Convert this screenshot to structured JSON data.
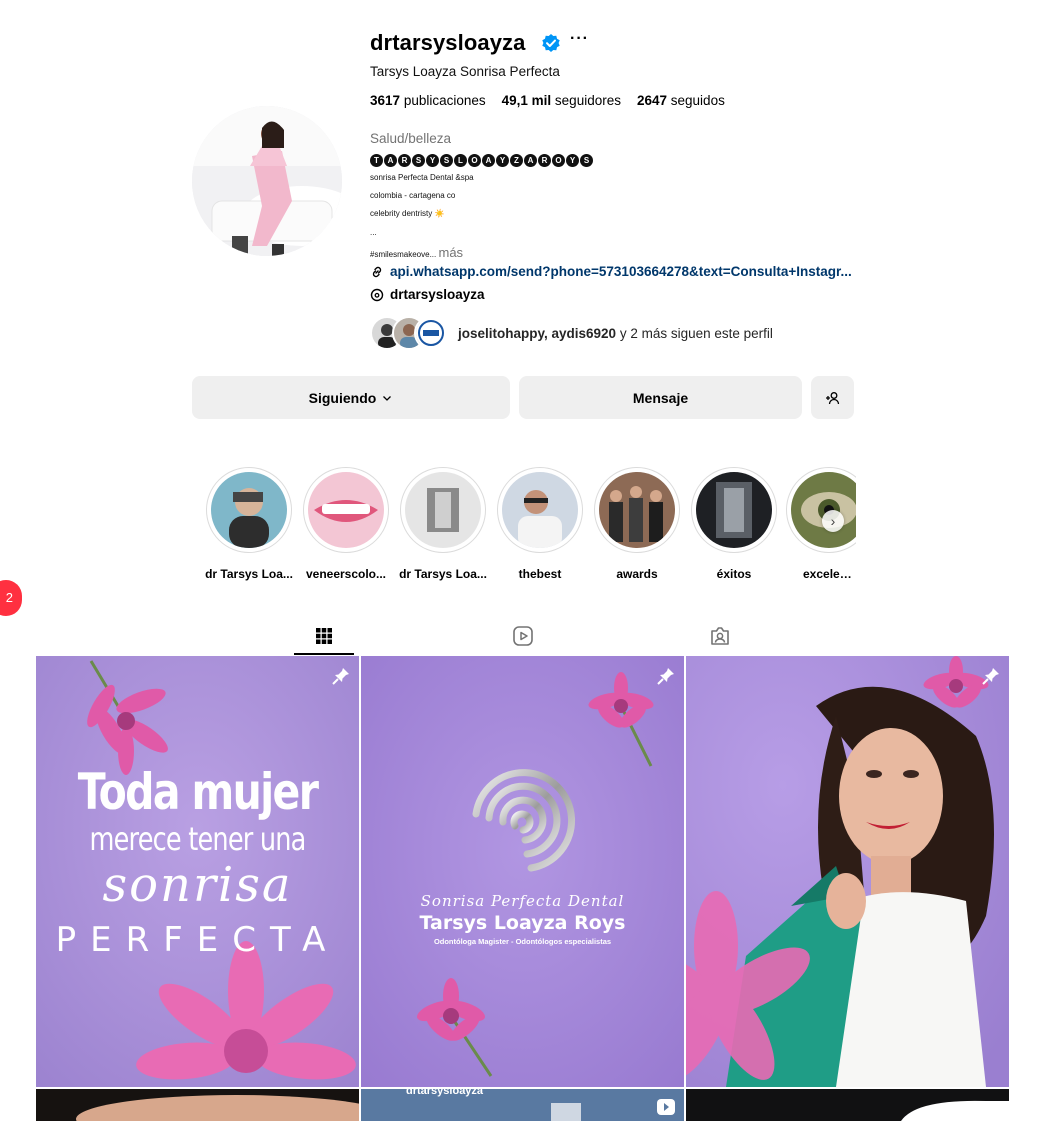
{
  "profile": {
    "username": "drtarsysloayza",
    "more_label": "···",
    "full_name": "Tarsys Loayza Sonrisa Perfecta",
    "stats": {
      "posts_count": "3617",
      "posts_label": "publicaciones",
      "followers_count": "49,1 mil",
      "followers_label": "seguidores",
      "following_count": "2647",
      "following_label": "seguidos"
    },
    "category": "Salud/belleza",
    "bio_name_letters": [
      "T",
      "A",
      "R",
      "S",
      "Y",
      "S",
      "L",
      "O",
      "A",
      "Y",
      "Z",
      "A",
      "R",
      "O",
      "Y",
      "S"
    ],
    "bio_line_1": "sonrisa Perfecta Dental &spa",
    "bio_line_2": "colombia - cartagena co",
    "bio_line_3": "celebrity dentristy ☀️",
    "bio_ellipsis": "...",
    "bio_tag": "#smilesmakeove...",
    "bio_more": "más",
    "link": "api.whatsapp.com/send?phone=573103664278&text=Consulta+Instagr...",
    "threads_handle": "drtarsysloayza",
    "followed_by_users": "joselitohappy, aydis6920",
    "followed_by_rest": "y 2 más siguen este perfil"
  },
  "buttons": {
    "following": "Siguiendo",
    "message": "Mensaje"
  },
  "highlights": [
    {
      "label": "dr Tarsys Loa..."
    },
    {
      "label": "veneerscolo..."
    },
    {
      "label": "dr Tarsys Loa..."
    },
    {
      "label": "thebest"
    },
    {
      "label": "awards"
    },
    {
      "label": "éxitos"
    },
    {
      "label": "excelencia"
    }
  ],
  "notification_badge": "2",
  "posts": [
    {
      "line1": "Toda mujer",
      "line2": "merece tener una",
      "line3": "sonrisa",
      "line4": "PERFECTA"
    },
    {
      "line1": "Sonrisa Perfecta Dental",
      "line2": "Tarsys Loayza Roys",
      "line3": "Odontóloga Magister - Odontólogos especialistas"
    },
    {}
  ],
  "row2_caption": "drtarsysloayza",
  "colors": {
    "tile_purple": "#a58bd6",
    "flower_pink": "#e05aa8",
    "button_bg": "#efefef",
    "link_blue": "#00376b",
    "verified_blue": "#0095f6",
    "badge_red": "#ff3040"
  }
}
